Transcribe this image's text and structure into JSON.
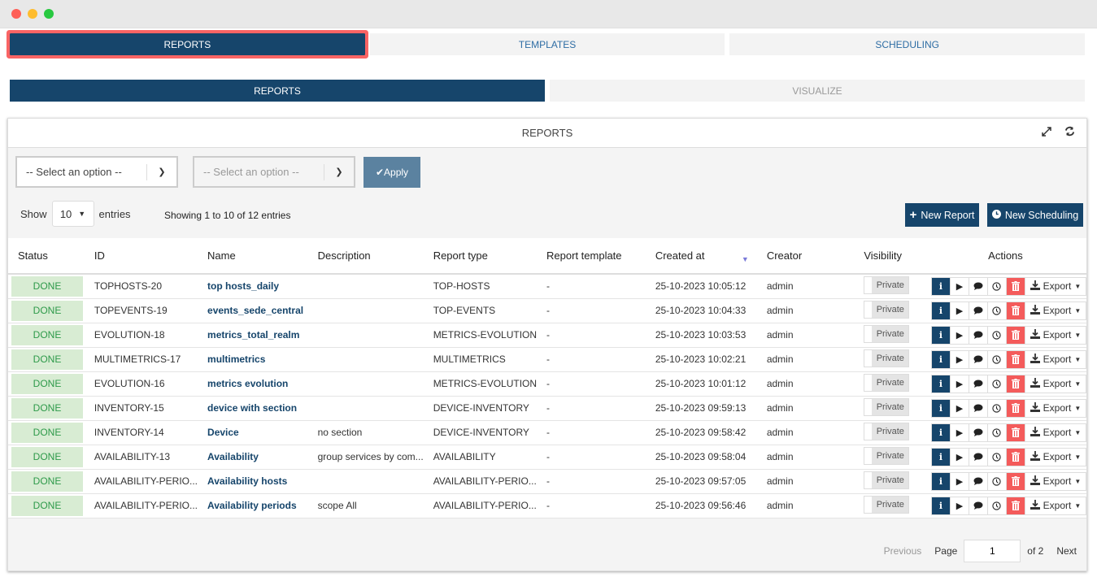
{
  "main_tabs": [
    {
      "label": "REPORTS",
      "active": true
    },
    {
      "label": "TEMPLATES",
      "active": false
    },
    {
      "label": "SCHEDULING",
      "active": false
    }
  ],
  "sub_tabs": [
    {
      "label": "REPORTS",
      "active": true
    },
    {
      "label": "VISUALIZE",
      "active": false
    }
  ],
  "panel": {
    "title": "REPORTS",
    "icons": [
      "expand-icon",
      "refresh-icon"
    ]
  },
  "filters": {
    "select1_placeholder": "-- Select an option --",
    "select2_placeholder": "-- Select an option --",
    "apply_label": "Apply"
  },
  "length": {
    "show_label": "Show",
    "value": "10",
    "entries_label": "entries"
  },
  "info": "Showing 1 to 10 of 12 entries",
  "buttons": {
    "new_report": "New Report",
    "new_scheduling": "New Scheduling"
  },
  "table": {
    "headers": [
      "Status",
      "ID",
      "Name",
      "Description",
      "Report type",
      "Report template",
      "Created at",
      "Creator",
      "Visibility",
      "Actions"
    ],
    "rows": [
      {
        "status": "DONE",
        "id": "TOPHOSTS-20",
        "name": "top hosts_daily",
        "description": "",
        "type": "TOP-HOSTS",
        "template": "-",
        "created": "25-10-2023 10:05:12",
        "creator": "admin",
        "visibility": "Private"
      },
      {
        "status": "DONE",
        "id": "TOPEVENTS-19",
        "name": "events_sede_central",
        "description": "",
        "type": "TOP-EVENTS",
        "template": "-",
        "created": "25-10-2023 10:04:33",
        "creator": "admin",
        "visibility": "Private"
      },
      {
        "status": "DONE",
        "id": "EVOLUTION-18",
        "name": "metrics_total_realm",
        "description": "",
        "type": "METRICS-EVOLUTION",
        "template": "-",
        "created": "25-10-2023 10:03:53",
        "creator": "admin",
        "visibility": "Private"
      },
      {
        "status": "DONE",
        "id": "MULTIMETRICS-17",
        "name": "multimetrics",
        "description": "",
        "type": "MULTIMETRICS",
        "template": "-",
        "created": "25-10-2023 10:02:21",
        "creator": "admin",
        "visibility": "Private"
      },
      {
        "status": "DONE",
        "id": "EVOLUTION-16",
        "name": "metrics evolution",
        "description": "",
        "type": "METRICS-EVOLUTION",
        "template": "-",
        "created": "25-10-2023 10:01:12",
        "creator": "admin",
        "visibility": "Private"
      },
      {
        "status": "DONE",
        "id": "INVENTORY-15",
        "name": "device with section",
        "description": "",
        "type": "DEVICE-INVENTORY",
        "template": "-",
        "created": "25-10-2023 09:59:13",
        "creator": "admin",
        "visibility": "Private"
      },
      {
        "status": "DONE",
        "id": "INVENTORY-14",
        "name": "Device",
        "description": "no section",
        "type": "DEVICE-INVENTORY",
        "template": "-",
        "created": "25-10-2023 09:58:42",
        "creator": "admin",
        "visibility": "Private"
      },
      {
        "status": "DONE",
        "id": "AVAILABILITY-13",
        "name": "Availability",
        "description": "group services by com...",
        "type": "AVAILABILITY",
        "template": "-",
        "created": "25-10-2023 09:58:04",
        "creator": "admin",
        "visibility": "Private"
      },
      {
        "status": "DONE",
        "id": "AVAILABILITY-PERIO...",
        "name": "Availability hosts",
        "description": "",
        "type": "AVAILABILITY-PERIO...",
        "template": "-",
        "created": "25-10-2023 09:57:05",
        "creator": "admin",
        "visibility": "Private"
      },
      {
        "status": "DONE",
        "id": "AVAILABILITY-PERIO...",
        "name": "Availability periods",
        "description": "scope All",
        "type": "AVAILABILITY-PERIO...",
        "template": "-",
        "created": "25-10-2023 09:56:46",
        "creator": "admin",
        "visibility": "Private"
      }
    ],
    "export_label": "Export"
  },
  "pagination": {
    "previous": "Previous",
    "page_label": "Page",
    "current": "1",
    "of_label": "of 2",
    "next": "Next"
  },
  "colors": {
    "primary": "#16456b",
    "highlight": "#f96464",
    "done_bg": "#d8ecd3",
    "done_text": "#2e9a4a",
    "delete": "#f45b5b",
    "apply": "#5b82a0"
  }
}
